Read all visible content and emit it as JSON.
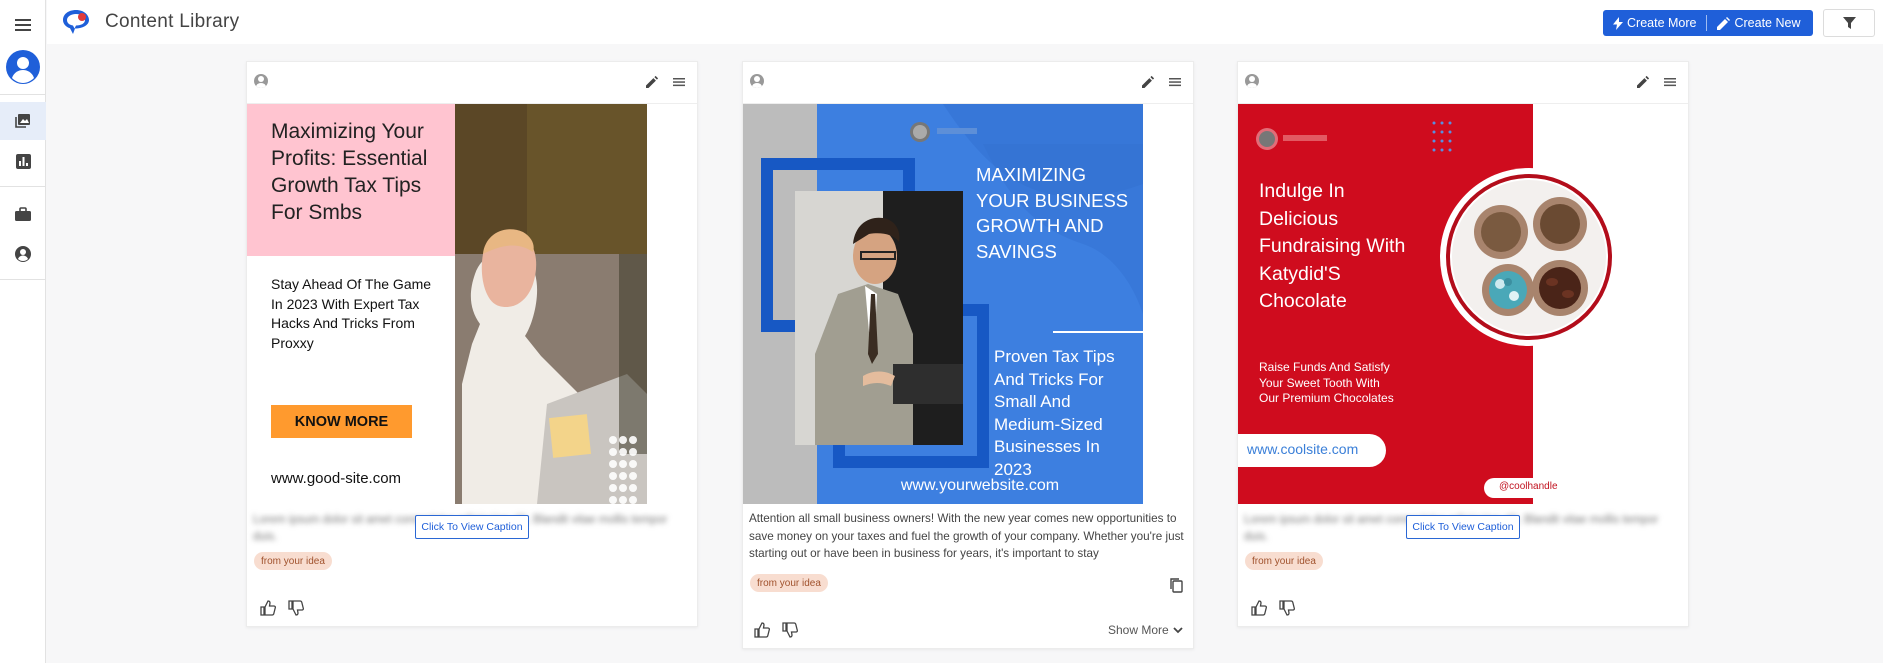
{
  "app": {
    "title": "Content Library"
  },
  "toolbar": {
    "create_more": "Create More",
    "create_new": "Create New"
  },
  "cards": [
    {
      "caption_placeholder": "Lorem ipsum dolor sit amet consectetur adipiscing elit. Blandit vitae mollis tempor duis.",
      "view_caption": "Click To View Caption",
      "tag": "from your idea",
      "poster": {
        "headline": "Maximizing Your Profits: Essential Growth Tax Tips For Smbs",
        "sub": "Stay Ahead Of The Game In 2023 With Expert Tax Hacks And Tricks From Proxxy",
        "cta": "KNOW MORE",
        "url": "www.good-site.com"
      }
    },
    {
      "caption": "Attention all small business owners! With the new year comes new opportunities to save money on your taxes and fuel the growth of your company. Whether you're just starting out or have been in business for years, it's important to stay",
      "tag": "from your idea",
      "show_more": "Show More",
      "poster": {
        "headline": "MAXIMIZING YOUR BUSINESS GROWTH AND SAVINGS",
        "sub": "Proven Tax Tips And Tricks For Small And Medium-Sized Businesses In 2023",
        "url": "www.yourwebsite.com"
      }
    },
    {
      "caption_placeholder": "Lorem ipsum dolor sit amet consectetur adipiscing elit. Blandit vitae mollis tempor duis.",
      "view_caption": "Click To View Caption",
      "tag": "from your idea",
      "poster": {
        "headline": "Indulge In Delicious Fundraising With Katydid'S Chocolate",
        "sub": "Raise Funds And Satisfy Your Sweet Tooth With Our Premium Chocolates",
        "url": "www.coolsite.com",
        "handle": "@coolhandle"
      }
    }
  ],
  "colors": {
    "primary": "#1f5fd9",
    "poster1_pink": "#ffc4d0",
    "poster1_orange": "#ff9a2e",
    "poster2_blue": "#3d7fe0",
    "poster3_red": "#cf0c1e"
  }
}
